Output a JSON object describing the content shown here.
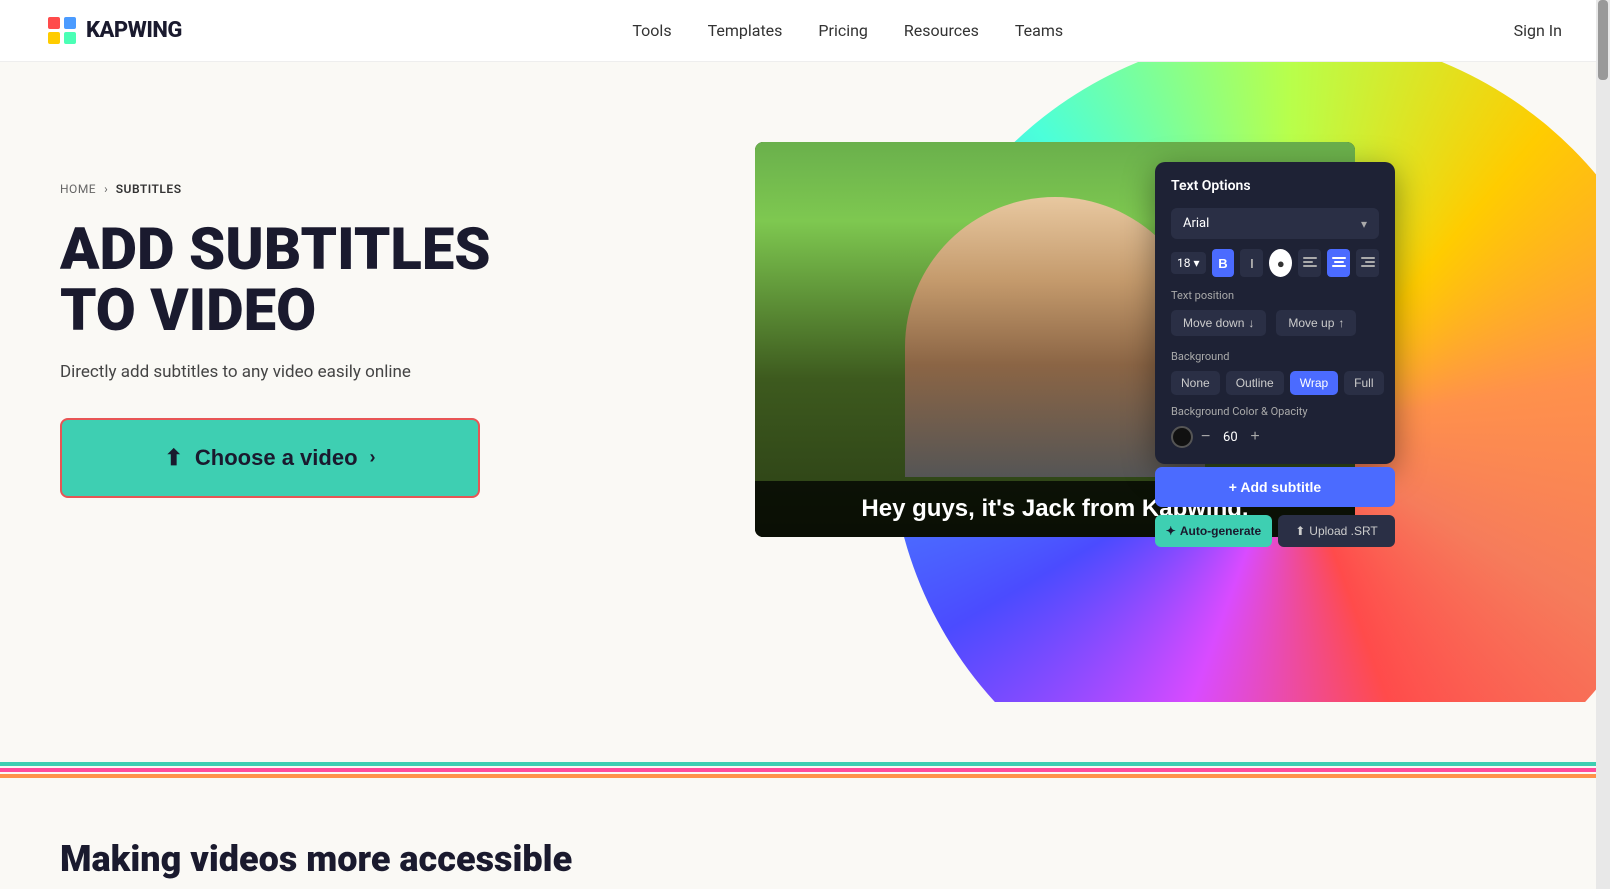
{
  "nav": {
    "logo_text": "KAPWING",
    "links": [
      {
        "label": "Tools",
        "id": "tools"
      },
      {
        "label": "Templates",
        "id": "templates"
      },
      {
        "label": "Pricing",
        "id": "pricing"
      },
      {
        "label": "Resources",
        "id": "resources"
      },
      {
        "label": "Teams",
        "id": "teams"
      }
    ],
    "sign_in": "Sign In"
  },
  "breadcrumb": {
    "home": "HOME",
    "separator": "›",
    "current": "SUBTITLES"
  },
  "hero": {
    "title_line1": "ADD SUBTITLES",
    "title_line2": "TO VIDEO",
    "subtitle": "Directly add subtitles to any video easily online",
    "cta_label": "Choose a video",
    "cta_arrow": "›"
  },
  "text_options_panel": {
    "title": "Text Options",
    "font": "Arial",
    "size": "18",
    "bold": "B",
    "italic": "I",
    "text_position_label": "Text position",
    "move_down": "Move down",
    "move_up": "Move up",
    "background_label": "Background",
    "bg_options": [
      "None",
      "Outline",
      "Wrap",
      "Full"
    ],
    "bg_color_label": "Background Color & Opacity",
    "opacity_value": "60",
    "add_subtitle": "+ Add subtitle",
    "auto_generate": "Auto-generate",
    "upload_srt": "Upload .SRT"
  },
  "video": {
    "subtitle_text": "Hey guys, it's Jack from Kapwing."
  },
  "bottom": {
    "title": "Making videos more accessible"
  },
  "color_lines": {
    "teal": "#3ecfb2",
    "pink": "#ff4b9b",
    "orange": "#ff914b"
  }
}
